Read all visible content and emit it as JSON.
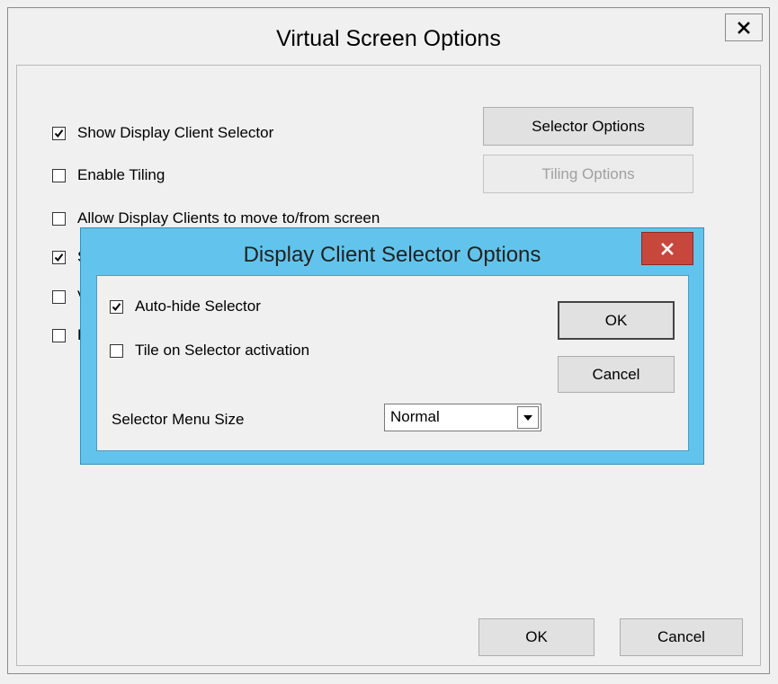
{
  "outer": {
    "title": "Virtual Screen Options",
    "checkboxes": [
      {
        "label": "Show Display Client Selector",
        "checked": true
      },
      {
        "label": "Enable Tiling",
        "checked": false
      },
      {
        "label": "Allow Display Clients to move to/from screen",
        "checked": false
      },
      {
        "label": "S",
        "checked": true
      },
      {
        "label": "V",
        "checked": false
      },
      {
        "label": "H",
        "checked": false
      }
    ],
    "selector_options_label": "Selector Options",
    "tiling_options_label": "Tiling Options",
    "ok_label": "OK",
    "cancel_label": "Cancel"
  },
  "inner": {
    "title": "Display Client Selector Options",
    "checkboxes": [
      {
        "label": "Auto-hide Selector",
        "checked": true
      },
      {
        "label": "Tile on Selector activation",
        "checked": false
      }
    ],
    "menu_size_label": "Selector Menu Size",
    "menu_size_value": "Normal",
    "ok_label": "OK",
    "cancel_label": "Cancel"
  },
  "icons": {
    "close": "close-icon",
    "check": "checkmark-icon",
    "dropdown": "chevron-down-icon"
  },
  "colors": {
    "inner_frame": "#62c4ec",
    "inner_close": "#c7473d",
    "window_bg": "#f0f0f0"
  }
}
